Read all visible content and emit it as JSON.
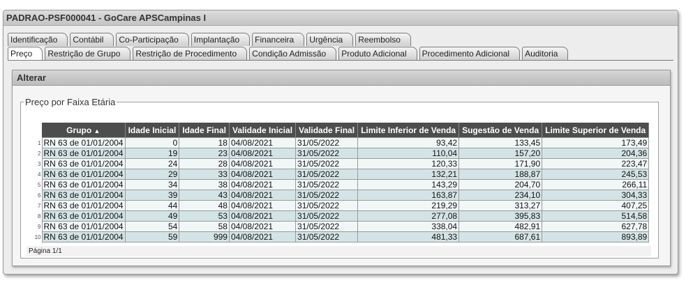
{
  "window": {
    "title": "PADRAO-PSF000041 - GoCare APSCampinas I"
  },
  "tabs_row1": [
    "Identificação",
    "Contábil",
    "Co-Participação",
    "Implantação",
    "Financeira",
    "Urgência",
    "Reembolso"
  ],
  "tabs_row2": [
    "Preço",
    "Restrição de Grupo",
    "Restrição de Procedimento",
    "Condição Admissão",
    "Produto Adicional",
    "Procedimento Adicional",
    "Auditoria"
  ],
  "panel": {
    "title": "Alterar",
    "fieldset_legend": "Preço por Faixa Etária"
  },
  "table": {
    "columns": [
      "Grupo",
      "Idade Inicial",
      "Idade Final",
      "Validade Inicial",
      "Validade Final",
      "Limite Inferior de Venda",
      "Sugestão de Venda",
      "Limite Superior de Venda"
    ],
    "sort_icon": "▲",
    "rows": [
      {
        "n": "1",
        "grupo": "RN 63 de 01/01/2004",
        "idade_ini": "0",
        "idade_fim": "18",
        "val_ini": "04/08/2021",
        "val_fim": "31/05/2022",
        "lim_inf": "93,42",
        "sugestao": "133,45",
        "lim_sup": "173,49"
      },
      {
        "n": "2",
        "grupo": "RN 63 de 01/01/2004",
        "idade_ini": "19",
        "idade_fim": "23",
        "val_ini": "04/08/2021",
        "val_fim": "31/05/2022",
        "lim_inf": "110,04",
        "sugestao": "157,20",
        "lim_sup": "204,36"
      },
      {
        "n": "3",
        "grupo": "RN 63 de 01/01/2004",
        "idade_ini": "24",
        "idade_fim": "28",
        "val_ini": "04/08/2021",
        "val_fim": "31/05/2022",
        "lim_inf": "120,33",
        "sugestao": "171,90",
        "lim_sup": "223,47"
      },
      {
        "n": "4",
        "grupo": "RN 63 de 01/01/2004",
        "idade_ini": "29",
        "idade_fim": "33",
        "val_ini": "04/08/2021",
        "val_fim": "31/05/2022",
        "lim_inf": "132,21",
        "sugestao": "188,87",
        "lim_sup": "245,53"
      },
      {
        "n": "5",
        "grupo": "RN 63 de 01/01/2004",
        "idade_ini": "34",
        "idade_fim": "38",
        "val_ini": "04/08/2021",
        "val_fim": "31/05/2022",
        "lim_inf": "143,29",
        "sugestao": "204,70",
        "lim_sup": "266,11"
      },
      {
        "n": "6",
        "grupo": "RN 63 de 01/01/2004",
        "idade_ini": "39",
        "idade_fim": "43",
        "val_ini": "04/08/2021",
        "val_fim": "31/05/2022",
        "lim_inf": "163,87",
        "sugestao": "234,10",
        "lim_sup": "304,33"
      },
      {
        "n": "7",
        "grupo": "RN 63 de 01/01/2004",
        "idade_ini": "44",
        "idade_fim": "48",
        "val_ini": "04/08/2021",
        "val_fim": "31/05/2022",
        "lim_inf": "219,29",
        "sugestao": "313,27",
        "lim_sup": "407,25"
      },
      {
        "n": "8",
        "grupo": "RN 63 de 01/01/2004",
        "idade_ini": "49",
        "idade_fim": "53",
        "val_ini": "04/08/2021",
        "val_fim": "31/05/2022",
        "lim_inf": "277,08",
        "sugestao": "395,83",
        "lim_sup": "514,58"
      },
      {
        "n": "9",
        "grupo": "RN 63 de 01/01/2004",
        "idade_ini": "54",
        "idade_fim": "58",
        "val_ini": "04/08/2021",
        "val_fim": "31/05/2022",
        "lim_inf": "338,04",
        "sugestao": "482,91",
        "lim_sup": "627,78"
      },
      {
        "n": "10",
        "grupo": "RN 63 de 01/01/2004",
        "idade_ini": "59",
        "idade_fim": "999",
        "val_ini": "04/08/2021",
        "val_fim": "31/05/2022",
        "lim_inf": "481,33",
        "sugestao": "687,61",
        "lim_sup": "893,89"
      }
    ]
  },
  "pager": {
    "label": "Página 1/1"
  }
}
